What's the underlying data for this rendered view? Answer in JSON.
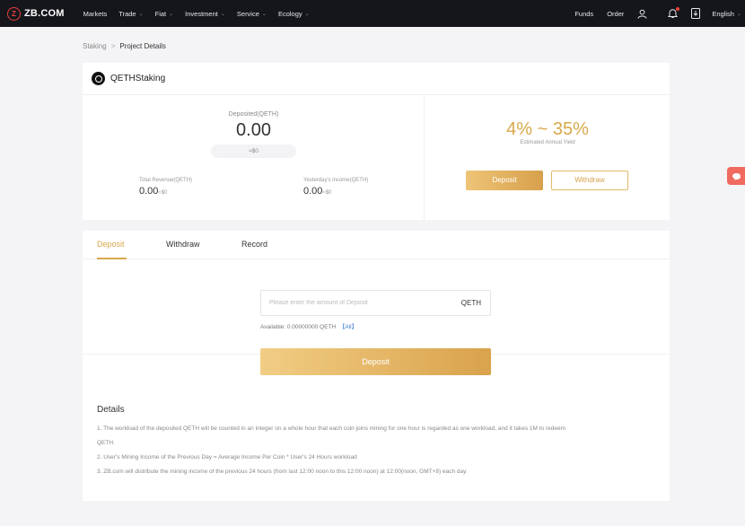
{
  "nav": {
    "logo_text": "ZB.COM",
    "logo_mark": "Z",
    "menu": [
      {
        "label": "Markets",
        "has_caret": false
      },
      {
        "label": "Trade",
        "has_caret": true
      },
      {
        "label": "Fiat",
        "has_caret": true
      },
      {
        "label": "Investment",
        "has_caret": true
      },
      {
        "label": "Service",
        "has_caret": true
      },
      {
        "label": "Ecology",
        "has_caret": true
      }
    ],
    "funds": "Funds",
    "order": "Order",
    "language": "English",
    "icons": [
      "user-icon",
      "bell-icon",
      "download-icon"
    ]
  },
  "breadcrumb": {
    "parent": "Staking",
    "separator": ">",
    "current": "Project Details"
  },
  "project": {
    "name": "QETHStaking",
    "deposited_label": "Deposited(QETH)",
    "deposited_value": "0.00",
    "deposited_usd": "≈$0",
    "total_revenue_label": "Total Revenue(QETH)",
    "total_revenue_value": "0.00",
    "total_revenue_usd": "≈$0",
    "yesterday_label": "Yesterday's income(QETH)",
    "yesterday_value": "0.00",
    "yesterday_usd": "≈$0",
    "yield_range": "4% ~ 35%",
    "yield_label": "Estimated Annual Yield",
    "deposit_button": "Deposit",
    "withdraw_button": "Withdraw"
  },
  "tabs": [
    {
      "label": "Deposit",
      "active": true
    },
    {
      "label": "Withdraw",
      "active": false
    },
    {
      "label": "Record",
      "active": false
    }
  ],
  "deposit_form": {
    "placeholder": "Please enter the amount of Deposit",
    "value": "",
    "unit": "QETH",
    "available_label": "Available:",
    "available_value": "0.00000000 QETH",
    "all_link": "【All】",
    "submit": "Deposit"
  },
  "details": {
    "title": "Details",
    "lines": [
      "1. The workload of the deposited QETH will be counted in an integer on a whole hour that each coin joins mining for one hour is regarded as one workload, and it takes 1M to redeem",
      "QETH.",
      "2. User's Mining Income of the Previous Day = Average Income Per Coin * User's 24 Hours workload",
      "3. ZB.com will distribute the mining income of the previous 24 hours (from last 12:00 noon to this 12:00 noon) at 12:00(noon, GMT+8) each day."
    ]
  },
  "colors": {
    "accent": "#d8a84b",
    "nav_bg": "#15161c",
    "brand_red": "#e8403a",
    "link_blue": "#3b7bd8"
  }
}
